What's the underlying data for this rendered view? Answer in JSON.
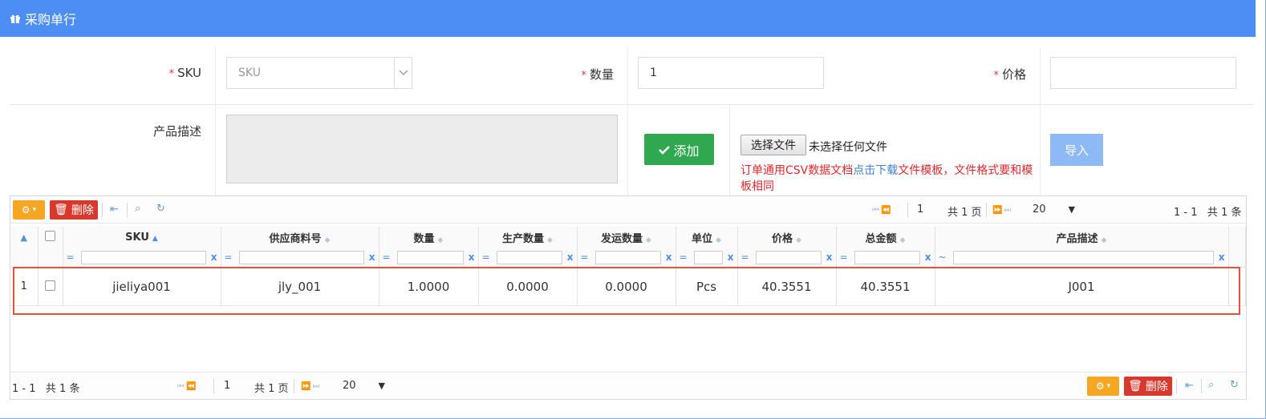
{
  "header": {
    "title": "采购单行",
    "icon": "gift-icon"
  },
  "form": {
    "sku_label": "SKU",
    "sku_placeholder": "SKU",
    "qty_label": "数量",
    "qty_value": "1",
    "price_label": "价格",
    "price_value": "",
    "desc_label": "产品描述",
    "required_mark": "*",
    "add_label": "添加",
    "choose_file_label": "选择文件",
    "file_status": "未选择任何文件",
    "note_prefix": "订单通用CSV数据文档",
    "note_link": "点击下载",
    "note_suffix": "文件模板，文件格式要和模板相同",
    "import_label": "导入"
  },
  "toolbar": {
    "delete_label": "删除",
    "page_current": "1",
    "page_total": "共 1 页",
    "page_size": "20",
    "range": "1 - 1",
    "count": "共 1 条"
  },
  "table": {
    "columns": [
      "SKU",
      "供应商料号",
      "数量",
      "生产数量",
      "发运数量",
      "单位",
      "价格",
      "总金额",
      "产品描述"
    ],
    "filter_ops": [
      "=",
      "=",
      "=",
      "=",
      "=",
      "=",
      "=",
      "=",
      "~"
    ],
    "filter_clear": "x",
    "rows": [
      {
        "index": "1",
        "sku": "jieliya001",
        "supplier_part": "jly_001",
        "qty": "1.0000",
        "prod_qty": "0.0000",
        "ship_qty": "0.0000",
        "unit": "Pcs",
        "price": "40.3551",
        "total": "40.3551",
        "desc": "J001"
      }
    ]
  },
  "colors": {
    "header": "#4d8ef4",
    "add": "#2fa84f",
    "delete": "#d9392c",
    "gear": "#f5a623",
    "import": "#8db9f6",
    "highlight": "#ea4f3c"
  }
}
